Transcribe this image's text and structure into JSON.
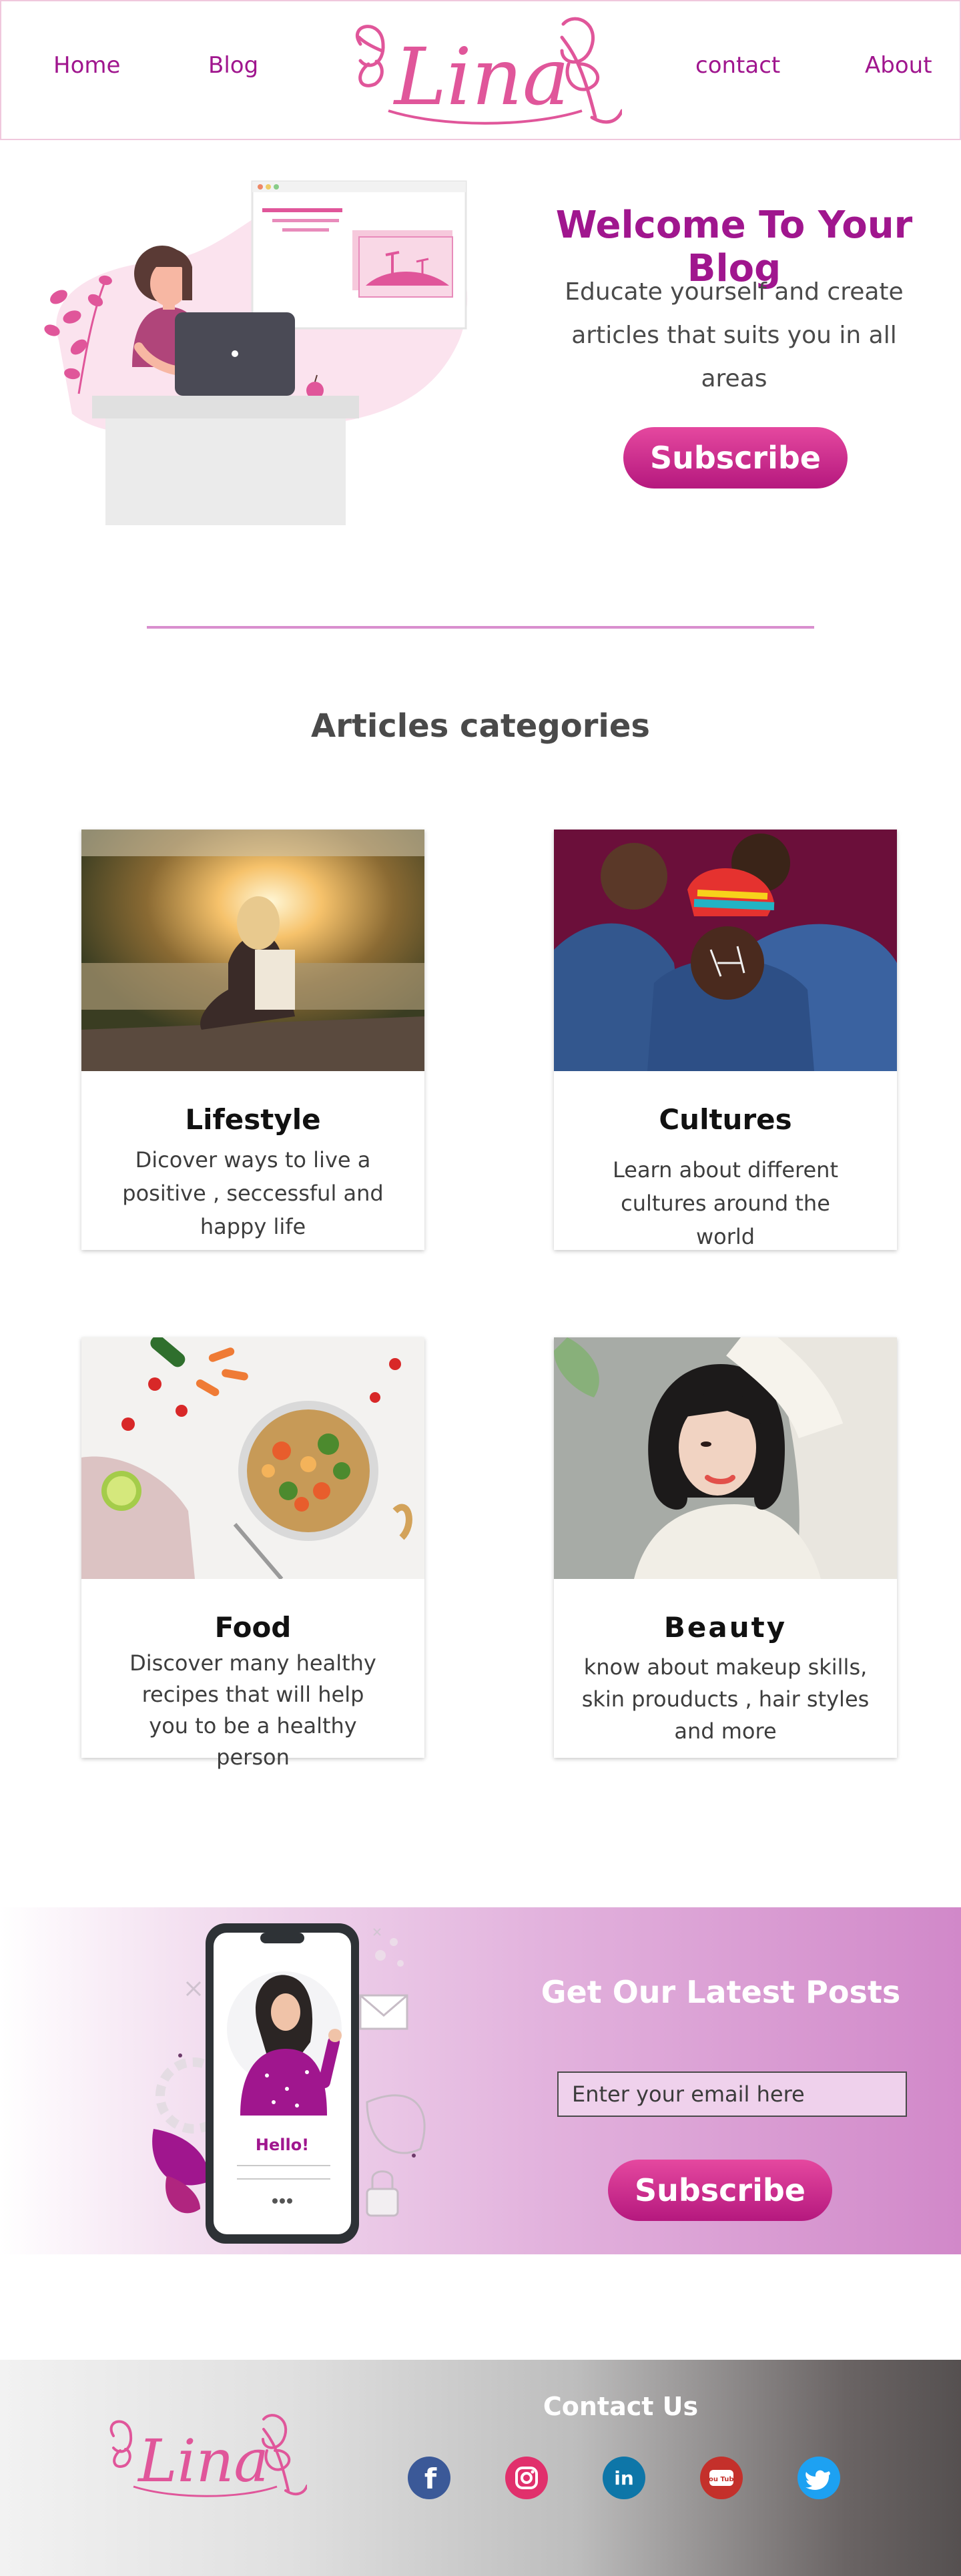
{
  "header": {
    "nav": [
      {
        "label": "Home"
      },
      {
        "label": "Blog"
      },
      {
        "label": "contact"
      },
      {
        "label": "About"
      }
    ],
    "logo_text": "Lina"
  },
  "hero": {
    "title": "Welcome To Your Blog",
    "text": "Educate yourself and create articles that suits you in all areas",
    "button": "Subscribe",
    "illustration": "woman-at-laptop-illustration"
  },
  "categories": {
    "title": "Articles categories",
    "items": [
      {
        "title": "Lifestyle",
        "text": "Dicover ways to live a positive , seccessful and happy life",
        "image": "woman-sitting-by-lake-sunset-photo"
      },
      {
        "title": "Cultures",
        "text": "Learn about different cultures around the world",
        "image": "group-of-women-traditional-dress-photo"
      },
      {
        "title": "Food",
        "text": "Discover many healthy recipes that will help you to be a healthy person",
        "image": "healthy-salad-bowl-photo"
      },
      {
        "title": "Beauty",
        "text": "know about makeup skills, skin prouducts , hair styles and more",
        "image": "woman-portrait-beauty-photo"
      }
    ]
  },
  "newsletter": {
    "title": "Get Our Latest Posts",
    "email_placeholder": "Enter your email here",
    "button": "Subscribe",
    "phone_greeting": "Hello!"
  },
  "footer": {
    "logo_text": "Lina",
    "contact_title": "Contact Us",
    "social": [
      {
        "name": "facebook-icon",
        "glyph": "f",
        "color": "#3b5998"
      },
      {
        "name": "instagram-icon",
        "glyph": "",
        "color": "#e1306c"
      },
      {
        "name": "linkedin-icon",
        "glyph": "in",
        "color": "#0e76a8"
      },
      {
        "name": "youtube-icon",
        "glyph": "You Tube",
        "color": "#c4302b"
      },
      {
        "name": "twitter-icon",
        "glyph": "",
        "color": "#1da1f2"
      }
    ]
  },
  "colors": {
    "brand": "#a0168e",
    "logo_pink": "#e0569a",
    "divider": "#d98fce"
  }
}
